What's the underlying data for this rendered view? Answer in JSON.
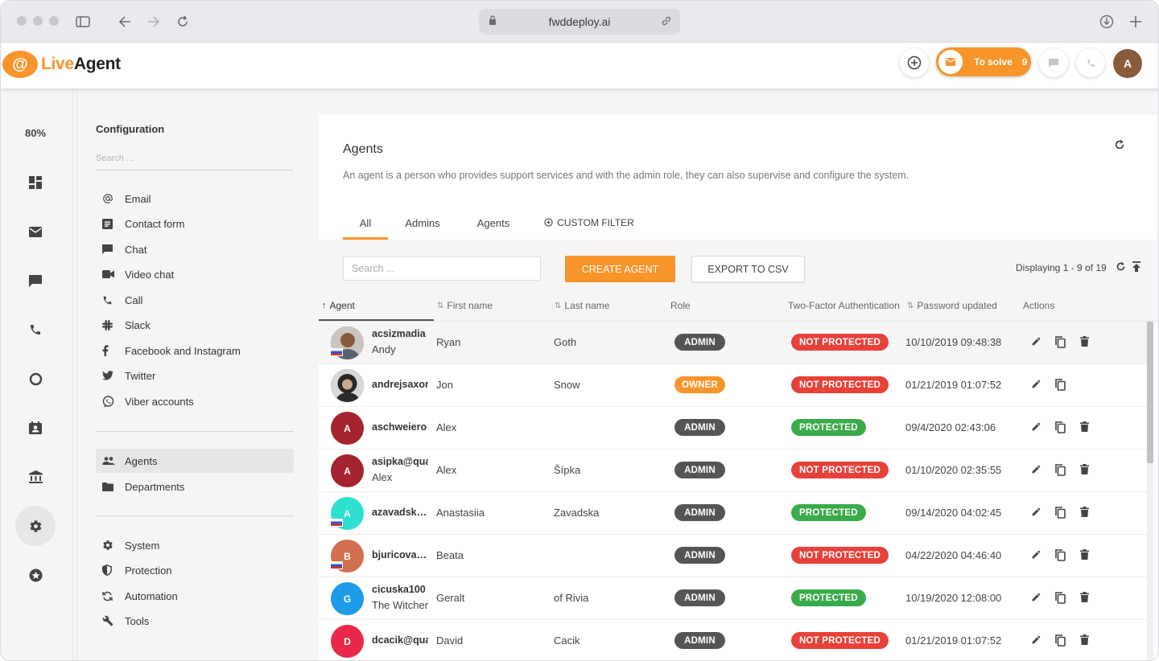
{
  "browser": {
    "url": "fwddeploy.ai"
  },
  "header": {
    "logo_live": "Live",
    "logo_agent": "Agent",
    "logo_at": "@",
    "to_solve_label": "To solve",
    "to_solve_count": "9",
    "avatar_initial": "A",
    "accent_color": "#f7942a"
  },
  "rail": {
    "zoom": "80%",
    "icons": [
      "dashboard-icon",
      "mail-icon",
      "chat-icon",
      "phone-icon",
      "reports-icon",
      "contacts-icon",
      "knowledgebase-icon",
      "settings-icon",
      "plugins-icon"
    ]
  },
  "config": {
    "title": "Configuration",
    "search_placeholder": "Search ...",
    "channels": [
      {
        "label": "Email",
        "icon": "at-icon"
      },
      {
        "label": "Contact form",
        "icon": "form-icon"
      },
      {
        "label": "Chat",
        "icon": "chat-icon"
      },
      {
        "label": "Video chat",
        "icon": "video-icon"
      },
      {
        "label": "Call",
        "icon": "phone-icon"
      },
      {
        "label": "Slack",
        "icon": "slack-icon"
      },
      {
        "label": "Facebook and Instagram",
        "icon": "facebook-icon"
      },
      {
        "label": "Twitter",
        "icon": "twitter-icon"
      },
      {
        "label": "Viber accounts",
        "icon": "viber-icon"
      }
    ],
    "people": [
      {
        "label": "Agents",
        "icon": "people-icon"
      },
      {
        "label": "Departments",
        "icon": "folder-icon"
      }
    ],
    "system": [
      {
        "label": "System",
        "icon": "gear-icon"
      },
      {
        "label": "Protection",
        "icon": "shield-icon"
      },
      {
        "label": "Automation",
        "icon": "sync-icon"
      },
      {
        "label": "Tools",
        "icon": "wrench-icon"
      }
    ]
  },
  "main": {
    "title": "Agents",
    "description": "An agent is a person who provides support services and with the admin role, they can also supervise and configure the system.",
    "tabs": [
      {
        "label": "All"
      },
      {
        "label": "Admins"
      },
      {
        "label": "Agents"
      },
      {
        "label": "CUSTOM FILTER"
      }
    ],
    "search_placeholder": "Search ...",
    "create_label": "CREATE AGENT",
    "export_label": "EXPORT TO CSV",
    "displaying": "Displaying 1 - 9 of 19",
    "columns": {
      "agent": "Agent",
      "first_name": "First name",
      "last_name": "Last name",
      "role": "Role",
      "tfa": "Two-Factor Authentication",
      "password_updated": "Password updated",
      "actions": "Actions"
    },
    "rows": [
      {
        "username": "acsizmadia",
        "fullname": "Andy",
        "first": "Ryan",
        "last": "Goth",
        "role": "ADMIN",
        "tfa": "NOT PROTECTED",
        "updated": "10/10/2019 09:48:38"
      },
      {
        "username": "andrejsaxon",
        "fullname": "",
        "first": "Jon",
        "last": "Snow",
        "role": "OWNER",
        "tfa": "NOT PROTECTED",
        "updated": "01/21/2019 01:07:52"
      },
      {
        "username": "aschweiero",
        "fullname": "",
        "first": "Alex",
        "last": "",
        "role": "ADMIN",
        "tfa": "PROTECTED",
        "updated": "09/4/2020 02:43:06",
        "initial": "A"
      },
      {
        "username": "asipka@qua",
        "fullname": "Alex",
        "first": "Alex",
        "last": "Šípka",
        "role": "ADMIN",
        "tfa": "NOT PROTECTED",
        "updated": "01/10/2020 02:35:55",
        "initial": "A"
      },
      {
        "username": "azavadska...",
        "fullname": "",
        "first": "Anastasiia",
        "last": "Zavadska",
        "role": "ADMIN",
        "tfa": "PROTECTED",
        "updated": "09/14/2020 04:02:45",
        "initial": "A"
      },
      {
        "username": "bjuricova@...",
        "fullname": "",
        "first": "Beata",
        "last": "",
        "role": "ADMIN",
        "tfa": "NOT PROTECTED",
        "updated": "04/22/2020 04:46:40",
        "initial": "B"
      },
      {
        "username": "cicuska100",
        "fullname": "The Witcher",
        "first": "Geralt",
        "last": "of Rivia",
        "role": "ADMIN",
        "tfa": "PROTECTED",
        "updated": "10/19/2020 12:08:00",
        "initial": "G"
      },
      {
        "username": "dcacik@qua",
        "fullname": "",
        "first": "David",
        "last": "Cacik",
        "role": "ADMIN",
        "tfa": "NOT PROTECTED",
        "updated": "01/21/2019 01:07:52",
        "initial": "D"
      }
    ],
    "colors": {
      "admin": "#555555",
      "owner": "#f7942a",
      "protected": "#3aab4a",
      "not_protected": "#e8413a"
    }
  }
}
